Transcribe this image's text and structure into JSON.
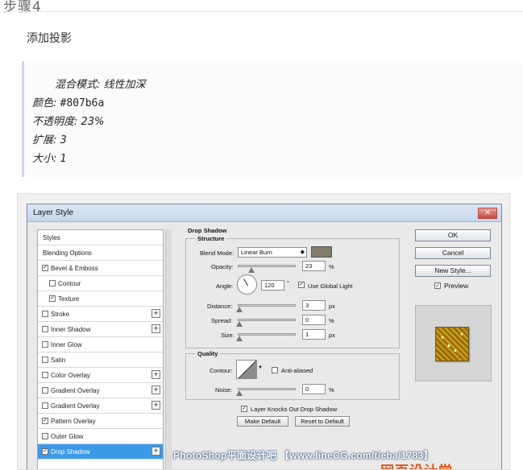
{
  "header": {
    "step_title": "步骤4",
    "subtitle": "添加投影"
  },
  "settings": {
    "blend_mode": "混合模式: 线性加深",
    "color_label": "颜色:",
    "color_value": "#807b6a",
    "opacity": "不透明度: 23%",
    "spread": "扩展: 3",
    "size": "大小: 1"
  },
  "dialog": {
    "title": "Layer Style",
    "close_glyph": "✕",
    "styles_list": [
      {
        "label": "Styles",
        "checkbox": false,
        "checked": false,
        "plus": false,
        "indent": false,
        "selected": false
      },
      {
        "label": "Blending Options",
        "checkbox": false,
        "checked": false,
        "plus": false,
        "indent": false,
        "selected": false
      },
      {
        "label": "Bevel & Emboss",
        "checkbox": true,
        "checked": true,
        "plus": false,
        "indent": false,
        "selected": false
      },
      {
        "label": "Contour",
        "checkbox": true,
        "checked": false,
        "plus": false,
        "indent": true,
        "selected": false
      },
      {
        "label": "Texture",
        "checkbox": true,
        "checked": true,
        "plus": false,
        "indent": true,
        "selected": false
      },
      {
        "label": "Stroke",
        "checkbox": true,
        "checked": false,
        "plus": true,
        "indent": false,
        "selected": false
      },
      {
        "label": "Inner Shadow",
        "checkbox": true,
        "checked": false,
        "plus": true,
        "indent": false,
        "selected": false
      },
      {
        "label": "Inner Glow",
        "checkbox": true,
        "checked": false,
        "plus": false,
        "indent": false,
        "selected": false
      },
      {
        "label": "Satin",
        "checkbox": true,
        "checked": false,
        "plus": false,
        "indent": false,
        "selected": false
      },
      {
        "label": "Color Overlay",
        "checkbox": true,
        "checked": false,
        "plus": true,
        "indent": false,
        "selected": false
      },
      {
        "label": "Gradient Overlay",
        "checkbox": true,
        "checked": false,
        "plus": true,
        "indent": false,
        "selected": false
      },
      {
        "label": "Gradient Overlay",
        "checkbox": true,
        "checked": false,
        "plus": true,
        "indent": false,
        "selected": false
      },
      {
        "label": "Pattern Overlay",
        "checkbox": true,
        "checked": true,
        "plus": false,
        "indent": false,
        "selected": false
      },
      {
        "label": "Outer Glow",
        "checkbox": true,
        "checked": false,
        "plus": false,
        "indent": false,
        "selected": false
      },
      {
        "label": "Drop Shadow",
        "checkbox": true,
        "checked": true,
        "plus": true,
        "indent": false,
        "selected": true
      }
    ],
    "panel": {
      "section_title": "Drop Shadow",
      "structure_title": "Structure",
      "blend_mode_label": "Blend Mode:",
      "blend_mode_value": "Linear Burn",
      "shadow_color": "#807b6a",
      "opacity_label": "Opacity:",
      "opacity_value": "23",
      "opacity_level": 0.23,
      "percent": "%",
      "angle_label": "Angle:",
      "angle_value": "120",
      "degree": "°",
      "use_global_light": "Use Global Light",
      "distance_label": "Distance:",
      "distance_value": "3",
      "spread_label": "Spread:",
      "spread_value": "0",
      "size_label": "Size:",
      "size_value": "1",
      "px": "px",
      "quality_title": "Quality",
      "contour_label": "Contour:",
      "anti_aliased": "Anti-aliased",
      "noise_label": "Noise:",
      "noise_value": "0",
      "knocks_out": "Layer Knocks Out Drop Shadow",
      "make_default": "Make Default",
      "reset_default": "Reset to Default"
    },
    "buttons": {
      "ok": "OK",
      "cancel": "Cancel",
      "new_style": "New Style...",
      "preview": "Preview"
    }
  },
  "watermark": {
    "text": "PhotoShop平面设计吧 【www.lineCG.com/tieba/1783】",
    "logo": "网页设计学"
  }
}
